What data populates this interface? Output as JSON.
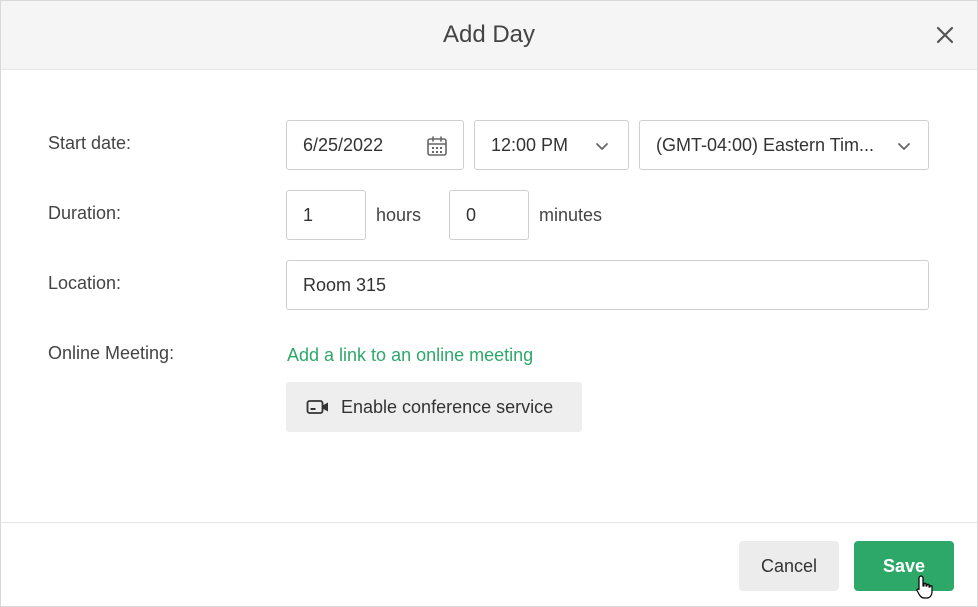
{
  "dialog": {
    "title": "Add Day",
    "close_icon": "close-icon"
  },
  "start_date": {
    "label": "Start date:",
    "date_value": "6/25/2022",
    "date_icon": "calendar-icon",
    "time_value": "12:00 PM",
    "timezone_value": "(GMT-04:00) Eastern Tim..."
  },
  "duration": {
    "label": "Duration:",
    "hours_value": "1",
    "hours_unit": "hours",
    "minutes_value": "0",
    "minutes_unit": "minutes"
  },
  "location": {
    "label": "Location:",
    "value": "Room 315"
  },
  "online_meeting": {
    "label": "Online Meeting:",
    "link_text": "Add a link to an online meeting",
    "conference_button_label": "Enable conference service",
    "conference_icon": "video-camera-icon"
  },
  "footer": {
    "cancel_label": "Cancel",
    "save_label": "Save"
  },
  "colors": {
    "accent": "#2ea869",
    "header_bg": "#f5f5f5"
  }
}
